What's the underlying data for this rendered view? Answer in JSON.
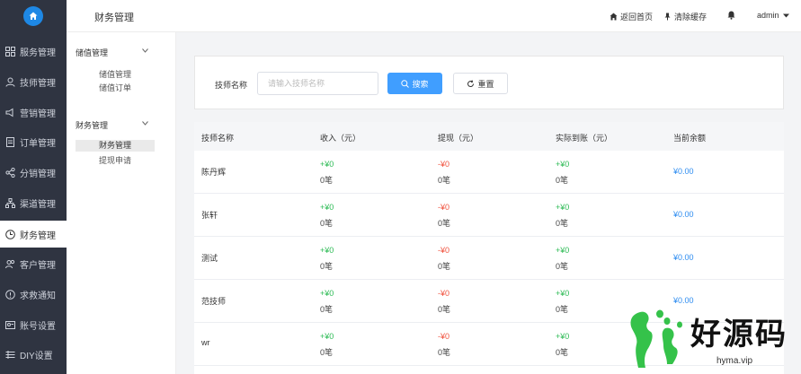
{
  "header": {
    "title": "财务管理",
    "home_link": "返回首页",
    "clear_cache": "清除缓存",
    "user": "admin"
  },
  "sidebar": {
    "items": [
      {
        "label": "服务管理",
        "icon": "grid-icon"
      },
      {
        "label": "技师管理",
        "icon": "user-icon"
      },
      {
        "label": "营销管理",
        "icon": "megaphone-icon"
      },
      {
        "label": "订单管理",
        "icon": "document-icon"
      },
      {
        "label": "分销管理",
        "icon": "share-icon"
      },
      {
        "label": "渠道管理",
        "icon": "network-icon"
      },
      {
        "label": "财务管理",
        "icon": "clock-icon",
        "active": true
      },
      {
        "label": "客户管理",
        "icon": "users-icon"
      },
      {
        "label": "求救通知",
        "icon": "alert-icon"
      },
      {
        "label": "账号设置",
        "icon": "account-icon"
      },
      {
        "label": "DIY设置",
        "icon": "diy-icon"
      }
    ]
  },
  "subnav": {
    "groups": [
      {
        "title": "储值管理",
        "items": [
          "储值管理",
          "储值订单"
        ]
      },
      {
        "title": "财务管理",
        "items": [
          "财务管理",
          "提现申请"
        ]
      }
    ]
  },
  "search": {
    "label": "技师名称",
    "placeholder": "请输入技师名称",
    "search_btn": "搜索",
    "reset_btn": "重置"
  },
  "table": {
    "headers": [
      "技师名称",
      "收入（元）",
      "提现（元）",
      "实际到账（元）",
      "当前余额"
    ],
    "rows": [
      {
        "name": "陈丹辉",
        "income": "+¥0",
        "income_count": "0笔",
        "withdraw": "-¥0",
        "withdraw_count": "0笔",
        "actual": "+¥0",
        "actual_count": "0笔",
        "balance": "¥0.00"
      },
      {
        "name": "张轩",
        "income": "+¥0",
        "income_count": "0笔",
        "withdraw": "-¥0",
        "withdraw_count": "0笔",
        "actual": "+¥0",
        "actual_count": "0笔",
        "balance": "¥0.00"
      },
      {
        "name": "测试",
        "income": "+¥0",
        "income_count": "0笔",
        "withdraw": "-¥0",
        "withdraw_count": "0笔",
        "actual": "+¥0",
        "actual_count": "0笔",
        "balance": "¥0.00"
      },
      {
        "name": "范技师",
        "income": "+¥0",
        "income_count": "0笔",
        "withdraw": "-¥0",
        "withdraw_count": "0笔",
        "actual": "+¥0",
        "actual_count": "0笔",
        "balance": "¥0.00"
      },
      {
        "name": "wr",
        "income": "+¥0",
        "income_count": "0笔",
        "withdraw": "-¥0",
        "withdraw_count": "0笔",
        "actual": "+¥0",
        "actual_count": "0笔",
        "balance": ""
      }
    ]
  },
  "watermark": {
    "text": "好源码",
    "url": "hyma.vip"
  },
  "colors": {
    "sidebar_bg": "#2f3441",
    "primary": "#409eff",
    "income": "#2dbb55",
    "withdraw": "#f0533f",
    "balance": "#2d8cf0"
  }
}
